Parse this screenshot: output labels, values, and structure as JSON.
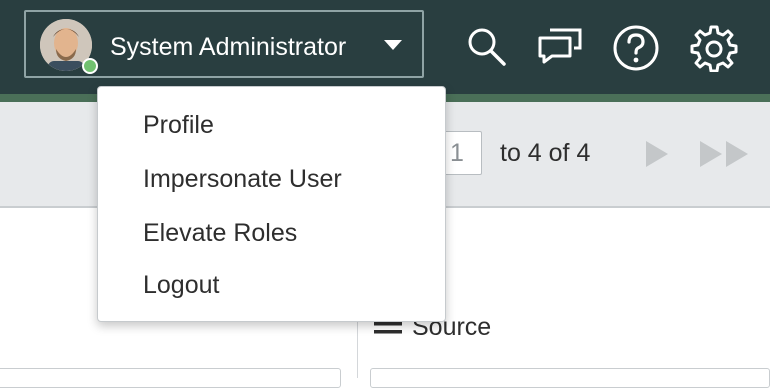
{
  "header": {
    "user_name": "System Administrator",
    "icons": [
      "search-icon",
      "conversations-icon",
      "help-icon",
      "settings-icon"
    ],
    "colors": {
      "background": "#293e40",
      "accent": "#4a6f58",
      "presence": "#71c170"
    }
  },
  "user_dropdown": {
    "items": [
      {
        "label": "Profile"
      },
      {
        "label": "Impersonate User"
      },
      {
        "label": "Elevate Roles"
      },
      {
        "label": "Logout"
      }
    ]
  },
  "list_controls": {
    "page_value": "1",
    "range_text": "to 4 of 4",
    "icons": [
      "next-page-icon",
      "last-page-icon"
    ]
  },
  "content": {
    "column_header": "Source"
  }
}
